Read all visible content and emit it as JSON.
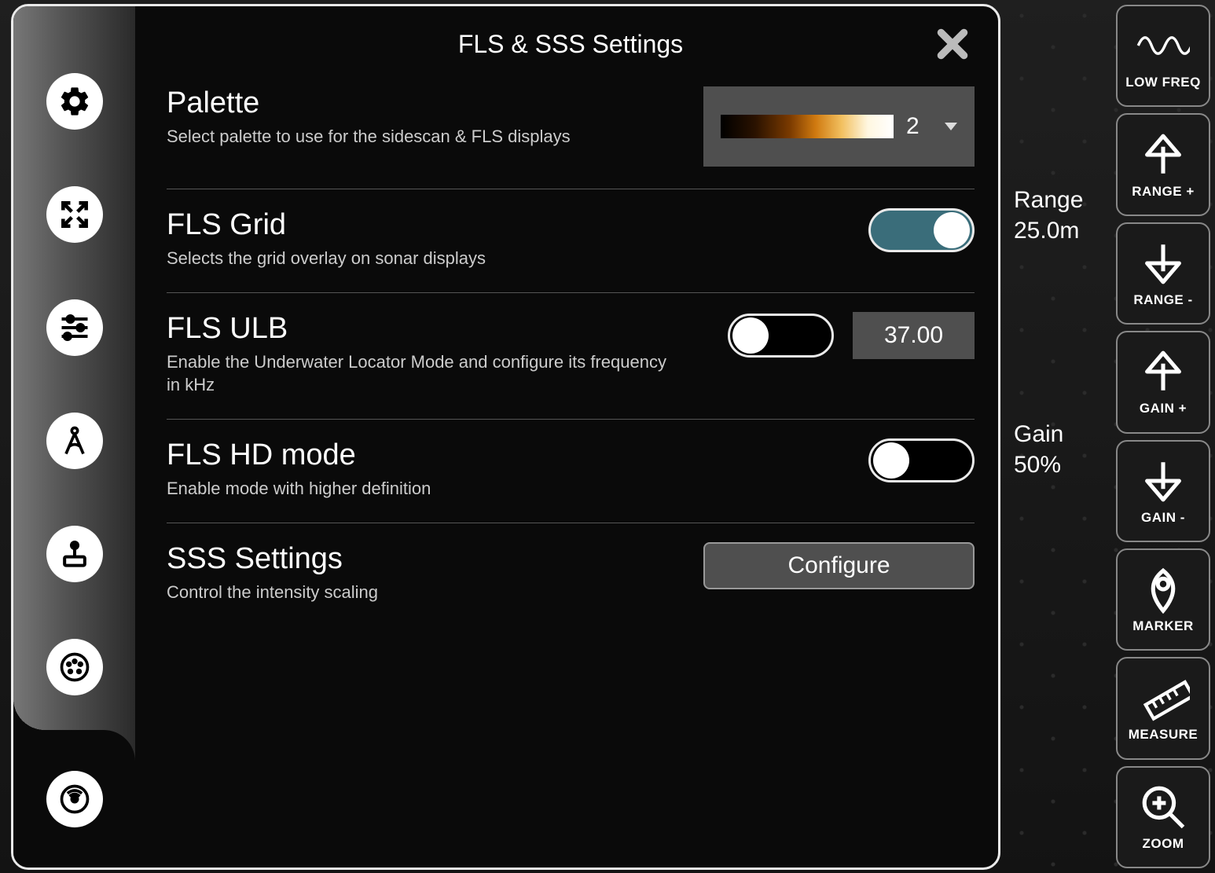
{
  "panel": {
    "title": "FLS & SSS Settings"
  },
  "sections": {
    "palette": {
      "heading": "Palette",
      "desc": "Select palette to use for the sidescan & FLS displays",
      "selected_index": "2"
    },
    "grid": {
      "heading": "FLS Grid",
      "desc": "Selects the grid overlay on sonar displays",
      "on": true
    },
    "ulb": {
      "heading": "FLS ULB",
      "desc": "Enable the Underwater Locator Mode and configure its frequency in kHz",
      "on": false,
      "freq": "37.00"
    },
    "hd": {
      "heading": "FLS HD mode",
      "desc": "Enable mode with higher definition",
      "on": false
    },
    "sss": {
      "heading": "SSS Settings",
      "desc": "Control the intensity scaling",
      "button": "Configure"
    }
  },
  "status": {
    "range_label": "Range",
    "range_value": "25.0m",
    "gain_label": "Gain",
    "gain_value": "50%"
  },
  "right_buttons": {
    "lowfreq": "LOW FREQ",
    "range_plus": "RANGE +",
    "range_minus": "RANGE -",
    "gain_plus": "GAIN +",
    "gain_minus": "GAIN -",
    "marker": "MARKER",
    "measure": "MEASURE",
    "zoom": "ZOOM"
  }
}
